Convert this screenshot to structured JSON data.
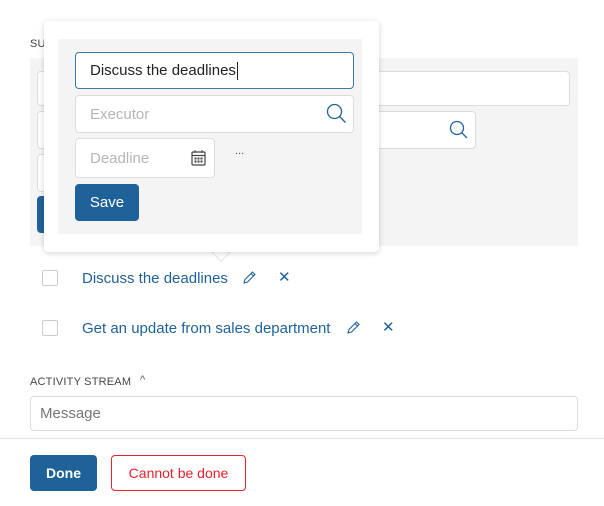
{
  "subtasks_label": "SUBTASKS",
  "popover": {
    "title_value": "Discuss the deadlines",
    "executor_placeholder": "Executor",
    "deadline_placeholder": "Deadline",
    "more": "...",
    "save_label": "Save"
  },
  "subtasks": [
    {
      "label": "Discuss the deadlines"
    },
    {
      "label": "Get an update from sales department"
    }
  ],
  "activity": {
    "label": "ACTIVITY STREAM",
    "message_placeholder": "Message"
  },
  "footer": {
    "done_label": "Done",
    "cannot_label": "Cannot be done"
  },
  "colors": {
    "accent": "#1f6299",
    "danger": "#e8222e"
  }
}
